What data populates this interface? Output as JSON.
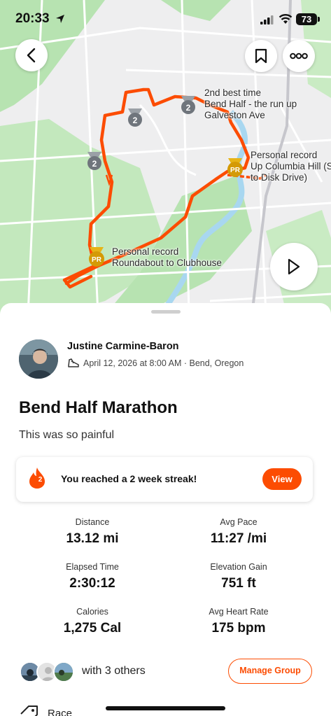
{
  "status_bar": {
    "time": "20:33",
    "battery": "73"
  },
  "map": {
    "labels": {
      "second_best": "2nd best time\nBend Half - the run up\nGalveston Ave",
      "pr_columbia": "Personal record\nUp Columbia Hill (S\nto Disk Drive)",
      "pr_roundabout": "Personal record\nRoundabout to Clubhouse"
    },
    "badges": {
      "second_rank": "2",
      "pr": "PR"
    }
  },
  "activity": {
    "athlete_name": "Justine  Carmine-Baron",
    "meta": "April 12, 2026 at 8:00 AM · Bend, Oregon",
    "title": "Bend Half Marathon",
    "description": "This was so painful"
  },
  "streak": {
    "count": "2",
    "message": "You reached a 2 week streak!",
    "button": "View"
  },
  "stats": [
    {
      "label": "Distance",
      "value": "13.12 mi"
    },
    {
      "label": "Avg Pace",
      "value": "11:27 /mi"
    },
    {
      "label": "Elapsed Time",
      "value": "2:30:12"
    },
    {
      "label": "Elevation Gain",
      "value": "751 ft"
    },
    {
      "label": "Calories",
      "value": "1,275 Cal"
    },
    {
      "label": "Avg Heart Rate",
      "value": "175 bpm"
    }
  ],
  "group": {
    "text": "with 3 others",
    "button": "Manage Group"
  },
  "race_row": {
    "label": "Race"
  },
  "colors": {
    "accent": "#fc4c02",
    "route": "#fc4c02",
    "park": "#b7e3b1",
    "water": "#a8d7f0"
  }
}
